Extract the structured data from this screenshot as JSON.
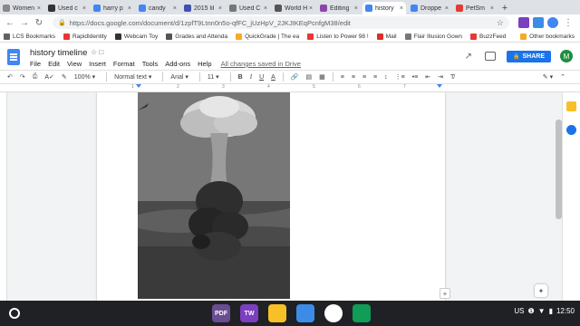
{
  "browser": {
    "tabs": [
      {
        "label": "Women",
        "color": "#888888"
      },
      {
        "label": "Used c",
        "color": "#333333"
      },
      {
        "label": "harry p",
        "color": "#4285f4"
      },
      {
        "label": "candy",
        "color": "#4285f4"
      },
      {
        "label": "2015 lil",
        "color": "#3f51b5"
      },
      {
        "label": "Used C",
        "color": "#777777"
      },
      {
        "label": "World H",
        "color": "#555555"
      },
      {
        "label": "Editing",
        "color": "#8e44ad"
      },
      {
        "label": "history",
        "color": "#4285f4",
        "active": true
      },
      {
        "label": "Droppe",
        "color": "#4285f4"
      },
      {
        "label": "PetSm",
        "color": "#e53935"
      }
    ],
    "new_tab": "+",
    "url": "https://docs.google.com/document/d/1zpfT9Ltnn0n5o-qfFC_jUzHpV_2JKJIKEqPcnfgM38/edit",
    "bookmarks": [
      {
        "label": "LCS Bookmarks",
        "color": "#5f6368"
      },
      {
        "label": "RapidIdentity",
        "color": "#e53935"
      },
      {
        "label": "Webcam Toy",
        "color": "#333333"
      },
      {
        "label": "Grades and Attenda",
        "color": "#555555"
      },
      {
        "label": "QuickGrade | The ea",
        "color": "#f9a825"
      },
      {
        "label": "Listen to Power 98 !",
        "color": "#e53935"
      },
      {
        "label": "Mail",
        "color": "#d93025"
      },
      {
        "label": "Flair Illusion Gown",
        "color": "#777777"
      },
      {
        "label": "BuzzFeed",
        "color": "#e53935"
      }
    ],
    "other_bookmarks": "Other bookmarks"
  },
  "docs": {
    "title": "history timeline",
    "menu": [
      "File",
      "Edit",
      "View",
      "Insert",
      "Format",
      "Tools",
      "Add-ons",
      "Help"
    ],
    "saved_status": "All changes saved in Drive",
    "share_label": "SHARE",
    "avatar_initial": "M",
    "zoom": "100%",
    "style": "Normal text",
    "font": "Arial",
    "font_size": "11",
    "ruler_numbers": [
      "1",
      "2",
      "3",
      "4",
      "5",
      "6",
      "7"
    ]
  },
  "shelf": {
    "locale": "US",
    "time": "12:50",
    "apps": [
      {
        "label": "PDF",
        "color": "#6a4c93"
      },
      {
        "label": "TW",
        "color": "#7b3fbf"
      },
      {
        "label": "",
        "color": "#f6c026"
      },
      {
        "label": "",
        "color": "#3c8ce7"
      },
      {
        "label": "",
        "color": "#ffffff"
      },
      {
        "label": "",
        "color": "#0f9d58"
      }
    ]
  }
}
